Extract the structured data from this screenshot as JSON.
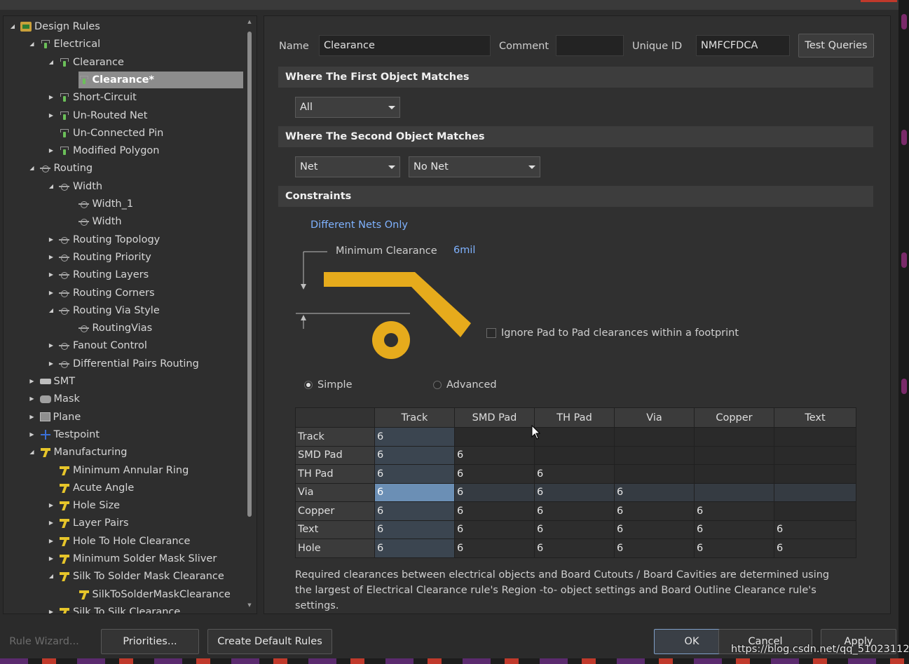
{
  "tree": {
    "items": [
      {
        "label": "Design Rules",
        "icon": "folder-icon",
        "level": 0,
        "expander": "down"
      },
      {
        "label": "Electrical",
        "icon": "rule-icon",
        "level": 1,
        "expander": "down"
      },
      {
        "label": "Clearance",
        "icon": "rule-icon",
        "level": 2,
        "expander": "down"
      },
      {
        "label": "Clearance*",
        "icon": "rule-icon",
        "level": 3,
        "expander": "none",
        "selected": true
      },
      {
        "label": "Short-Circuit",
        "icon": "rule-icon",
        "level": 2,
        "expander": "right"
      },
      {
        "label": "Un-Routed Net",
        "icon": "rule-icon",
        "level": 2,
        "expander": "right"
      },
      {
        "label": "Un-Connected Pin",
        "icon": "rule-icon",
        "level": 2,
        "expander": "none"
      },
      {
        "label": "Modified Polygon",
        "icon": "rule-icon",
        "level": 2,
        "expander": "right"
      },
      {
        "label": "Routing",
        "icon": "routing-icon",
        "level": 1,
        "expander": "down"
      },
      {
        "label": "Width",
        "icon": "routing-icon",
        "level": 2,
        "expander": "down"
      },
      {
        "label": "Width_1",
        "icon": "routing-icon",
        "level": 3,
        "expander": "none"
      },
      {
        "label": "Width",
        "icon": "routing-icon",
        "level": 3,
        "expander": "none"
      },
      {
        "label": "Routing Topology",
        "icon": "routing-icon",
        "level": 2,
        "expander": "right"
      },
      {
        "label": "Routing Priority",
        "icon": "routing-icon",
        "level": 2,
        "expander": "right"
      },
      {
        "label": "Routing Layers",
        "icon": "routing-icon",
        "level": 2,
        "expander": "right"
      },
      {
        "label": "Routing Corners",
        "icon": "routing-icon",
        "level": 2,
        "expander": "right"
      },
      {
        "label": "Routing Via Style",
        "icon": "routing-icon",
        "level": 2,
        "expander": "down"
      },
      {
        "label": "RoutingVias",
        "icon": "routing-icon",
        "level": 3,
        "expander": "none"
      },
      {
        "label": "Fanout Control",
        "icon": "routing-icon",
        "level": 2,
        "expander": "right"
      },
      {
        "label": "Differential Pairs Routing",
        "icon": "routing-icon",
        "level": 2,
        "expander": "right"
      },
      {
        "label": "SMT",
        "icon": "smt-icon",
        "level": 1,
        "expander": "right"
      },
      {
        "label": "Mask",
        "icon": "mask-icon",
        "level": 1,
        "expander": "right"
      },
      {
        "label": "Plane",
        "icon": "plane-icon",
        "level": 1,
        "expander": "right"
      },
      {
        "label": "Testpoint",
        "icon": "testpoint-icon",
        "level": 1,
        "expander": "right"
      },
      {
        "label": "Manufacturing",
        "icon": "manufacturing-icon",
        "level": 1,
        "expander": "down"
      },
      {
        "label": "Minimum Annular Ring",
        "icon": "manufacturing-icon",
        "level": 2,
        "expander": "none"
      },
      {
        "label": "Acute Angle",
        "icon": "manufacturing-icon",
        "level": 2,
        "expander": "none"
      },
      {
        "label": "Hole Size",
        "icon": "manufacturing-icon",
        "level": 2,
        "expander": "right"
      },
      {
        "label": "Layer Pairs",
        "icon": "manufacturing-icon",
        "level": 2,
        "expander": "right"
      },
      {
        "label": "Hole To Hole Clearance",
        "icon": "manufacturing-icon",
        "level": 2,
        "expander": "right"
      },
      {
        "label": "Minimum Solder Mask Sliver",
        "icon": "manufacturing-icon",
        "level": 2,
        "expander": "right"
      },
      {
        "label": "Silk To Solder Mask Clearance",
        "icon": "manufacturing-icon",
        "level": 2,
        "expander": "down"
      },
      {
        "label": "SilkToSolderMaskClearance",
        "icon": "manufacturing-icon",
        "level": 3,
        "expander": "none"
      },
      {
        "label": "Silk To Silk Clearance",
        "icon": "manufacturing-icon",
        "level": 2,
        "expander": "right"
      }
    ]
  },
  "rule": {
    "name_label": "Name",
    "name_value": "Clearance",
    "comment_label": "Comment",
    "comment_value": "",
    "uid_label": "Unique ID",
    "uid_value": "NMFCFDCA",
    "test_queries": "Test Queries"
  },
  "first_match": {
    "title": "Where The First Object Matches",
    "selected": "All"
  },
  "second_match": {
    "title": "Where The Second Object Matches",
    "selected_type": "Net",
    "selected_value": "No Net"
  },
  "constraints": {
    "title": "Constraints",
    "net_scope": "Different Nets Only",
    "min_clearance_label": "Minimum Clearance",
    "min_clearance_value": "6mil",
    "ignore_pad_label": "Ignore Pad to Pad clearances within a footprint",
    "ignore_pad_checked": false,
    "mode_simple": "Simple",
    "mode_advanced": "Advanced",
    "mode_selected": "Simple",
    "diagram_color": "#e6ab1c"
  },
  "matrix": {
    "columns": [
      "Track",
      "SMD Pad",
      "TH Pad",
      "Via",
      "Copper",
      "Text"
    ],
    "rows": [
      {
        "label": "Track",
        "values": [
          "6"
        ]
      },
      {
        "label": "SMD Pad",
        "values": [
          "6",
          "6"
        ]
      },
      {
        "label": "TH Pad",
        "values": [
          "6",
          "6",
          "6"
        ]
      },
      {
        "label": "Via",
        "values": [
          "6",
          "6",
          "6",
          "6"
        ]
      },
      {
        "label": "Copper",
        "values": [
          "6",
          "6",
          "6",
          "6",
          "6"
        ]
      },
      {
        "label": "Text",
        "values": [
          "6",
          "6",
          "6",
          "6",
          "6",
          "6"
        ]
      },
      {
        "label": "Hole",
        "values": [
          "6",
          "6",
          "6",
          "6",
          "6",
          "6"
        ]
      }
    ],
    "selected_row": "Via",
    "selected_column": "Track"
  },
  "note": "Required clearances between electrical objects and Board Cutouts / Board Cavities are determined using the largest of Electrical Clearance rule's Region -to- object settings and Board Outline Clearance rule's settings.",
  "footer": {
    "rule_wizard": "Rule Wizard...",
    "priorities": "Priorities...",
    "create_default": "Create Default Rules",
    "ok": "OK",
    "cancel": "Cancel",
    "apply": "Apply"
  },
  "watermark": "https://blog.csdn.net/qq_51023112"
}
